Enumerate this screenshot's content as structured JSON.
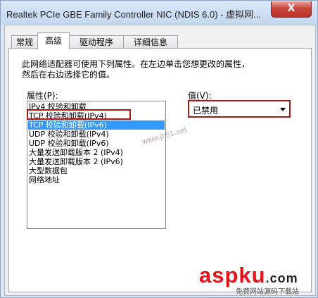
{
  "window": {
    "title": "Realtek PCIe GBE Family Controller NIC (NDIS 6.0) - 虚拟网...",
    "close_label": "X"
  },
  "tabs": [
    {
      "label": "常规",
      "active": false
    },
    {
      "label": "高级",
      "active": true
    },
    {
      "label": "驱动程序",
      "active": false
    },
    {
      "label": "详细信息",
      "active": false
    }
  ],
  "description": {
    "line1": "此网络适配器可使用下列属性。在左边单击您想更改的属性，",
    "line2": "然后在右边选择它的值。"
  },
  "property_label": "属性(P):",
  "value_label": "值(V):",
  "properties": [
    "IPv4 校验和卸载",
    "TCP 校验和卸载(IPv4)",
    "TCP 校验和卸载(IPv6)",
    "UDP 校验和卸载(IPv4)",
    "UDP 校验和卸载(IPv6)",
    "大量发送卸载版本 2 (IPv4)",
    "大量发送卸载版本 2 (IPv6)",
    "大型数据包",
    "网络地址"
  ],
  "selected_index": 2,
  "highlighted_index": 1,
  "value_select": {
    "selected": "已禁用"
  },
  "watermarks": {
    "center": "www.jb51.net",
    "logo_main": "asp",
    "logo_accent": "ku",
    "logo_dot": ".com",
    "logo_sub": "免费网站源码下载站"
  },
  "colors": {
    "selection": "#3399ff",
    "annotation_red": "#b01818",
    "close_button": "#c8453b"
  }
}
